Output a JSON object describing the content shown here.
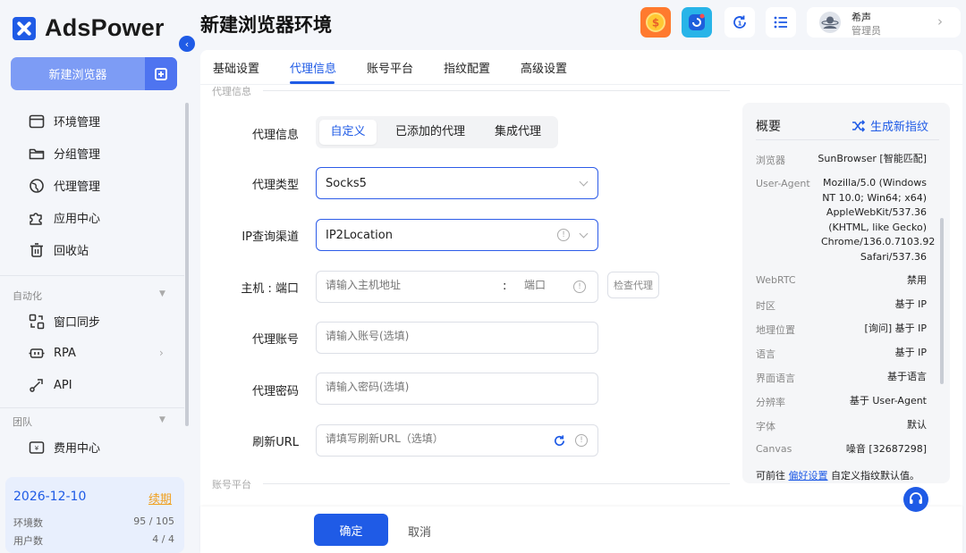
{
  "app": {
    "name": "AdsPower"
  },
  "sidebar": {
    "new_browser": "新建浏览器",
    "items": [
      {
        "label": "环境管理",
        "icon": "browser-window-icon"
      },
      {
        "label": "分组管理",
        "icon": "folder-icon"
      },
      {
        "label": "代理管理",
        "icon": "globe-icon"
      },
      {
        "label": "应用中心",
        "icon": "puzzle-icon"
      },
      {
        "label": "回收站",
        "icon": "trash-icon"
      }
    ],
    "automation_label": "自动化",
    "automation_items": [
      {
        "label": "窗口同步",
        "icon": "sync-windows-icon"
      },
      {
        "label": "RPA",
        "icon": "robot-icon"
      },
      {
        "label": "API",
        "icon": "api-icon"
      }
    ],
    "team_label": "团队",
    "team_items": [
      {
        "label": "费用中心",
        "icon": "billing-icon"
      }
    ],
    "plan": {
      "expiry": "2026-12-10",
      "renew": "续期",
      "env_label": "环境数",
      "env_value": "95 / 105",
      "user_label": "用户数",
      "user_value": "4 / 4"
    }
  },
  "header": {
    "title": "新建浏览器环境",
    "user": {
      "name": "希声",
      "role": "管理员"
    }
  },
  "tabs": [
    {
      "label": "基础设置"
    },
    {
      "label": "代理信息",
      "active": true
    },
    {
      "label": "账号平台"
    },
    {
      "label": "指纹配置"
    },
    {
      "label": "高级设置"
    }
  ],
  "form": {
    "group_title": "代理信息",
    "next_group_title": "账号平台",
    "proxy_info": {
      "label": "代理信息",
      "options": [
        "自定义",
        "已添加的代理",
        "集成代理"
      ],
      "selected": "自定义"
    },
    "proxy_type": {
      "label": "代理类型",
      "value": "Socks5"
    },
    "ip_channel": {
      "label": "IP查询渠道",
      "value": "IP2Location"
    },
    "host_port": {
      "label": "主机 : 端口",
      "host_placeholder": "请输入主机地址",
      "separator": ":",
      "port_placeholder": "端口",
      "check_button": "检查代理"
    },
    "account": {
      "label": "代理账号",
      "placeholder": "请输入账号(选填)"
    },
    "password": {
      "label": "代理密码",
      "placeholder": "请输入密码(选填)"
    },
    "refresh_url": {
      "label": "刷新URL",
      "placeholder": "请填写刷新URL（选填）"
    }
  },
  "summary": {
    "title": "概要",
    "generate": "生成新指纹",
    "rows": [
      {
        "key": "浏览器",
        "value": "SunBrowser [智能匹配]"
      },
      {
        "key": "User-Agent",
        "value": "Mozilla/5.0 (Windows NT 10.0; Win64; x64) AppleWebKit/537.36 (KHTML, like Gecko) Chrome/136.0.7103.92 Safari/537.36"
      },
      {
        "key": "WebRTC",
        "value": "禁用"
      },
      {
        "key": "时区",
        "value": "基于 IP"
      },
      {
        "key": "地理位置",
        "value": "[询问] 基于 IP"
      },
      {
        "key": "语言",
        "value": "基于 IP"
      },
      {
        "key": "界面语言",
        "value": "基于语言"
      },
      {
        "key": "分辨率",
        "value": "基于 User-Agent"
      },
      {
        "key": "字体",
        "value": "默认"
      },
      {
        "key": "Canvas",
        "value": "噪音 [32687298]"
      }
    ],
    "footer_prefix": "可前往",
    "footer_link": "偏好设置",
    "footer_suffix": "自定义指纹默认值。"
  },
  "footer": {
    "ok": "确定",
    "cancel": "取消"
  },
  "colors": {
    "primary": "#1f5be6",
    "primary_light": "#7d9cf5"
  }
}
